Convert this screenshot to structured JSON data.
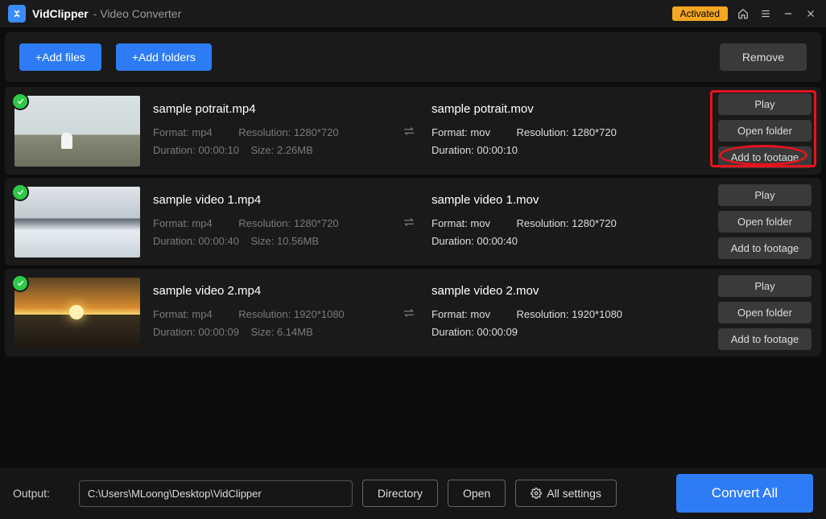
{
  "titlebar": {
    "app_name": "VidClipper",
    "app_sub": " - Video Converter",
    "activated": "Activated"
  },
  "toolbar": {
    "add_files": "+Add files",
    "add_folders": "+Add folders",
    "remove": "Remove"
  },
  "labels": {
    "format": "Format: ",
    "resolution": "Resolution: ",
    "duration": "Duration: ",
    "size": "Size: "
  },
  "actions": {
    "play": "Play",
    "open_folder": "Open folder",
    "add_footage": "Add to footage"
  },
  "files": [
    {
      "in_name": "sample potrait.mp4",
      "in_format": "mp4",
      "in_res": "1280*720",
      "in_dur": "00:00:10",
      "in_size": "2.26MB",
      "out_name": "sample potrait.mov",
      "out_format": "mov",
      "out_res": "1280*720",
      "out_dur": "00:00:10",
      "thumb": "sky"
    },
    {
      "in_name": "sample video 1.mp4",
      "in_format": "mp4",
      "in_res": "1280*720",
      "in_dur": "00:00:40",
      "in_size": "10.56MB",
      "out_name": "sample video 1.mov",
      "out_format": "mov",
      "out_res": "1280*720",
      "out_dur": "00:00:40",
      "thumb": "mtn"
    },
    {
      "in_name": "sample video 2.mp4",
      "in_format": "mp4",
      "in_res": "1920*1080",
      "in_dur": "00:00:09",
      "in_size": "6.14MB",
      "out_name": "sample video 2.mov",
      "out_format": "mov",
      "out_res": "1920*1080",
      "out_dur": "00:00:09",
      "thumb": "sun"
    }
  ],
  "footer": {
    "output_label": "Output:",
    "output_path": "C:\\Users\\MLoong\\Desktop\\VidClipper",
    "directory": "Directory",
    "open": "Open",
    "all_settings": "All settings",
    "convert_all": "Convert All"
  }
}
